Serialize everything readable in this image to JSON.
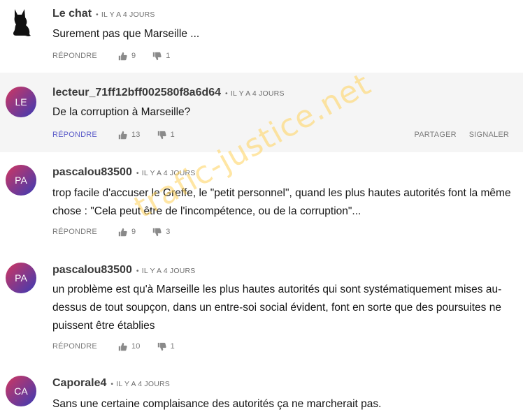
{
  "comments": [
    {
      "author": "Le chat",
      "time": "IL Y A 4 JOURS",
      "text": "Surement pas que Marseille ...",
      "reply": "RÉPONDRE",
      "up": "9",
      "down": "1",
      "avatar_icon": "black-cat-icon"
    },
    {
      "author": "lecteur_71ff12bff002580f8a6d64",
      "time": "IL Y A 4 JOURS",
      "text": "De la corruption à Marseille?",
      "reply": "RÉPONDRE",
      "up": "13",
      "down": "1",
      "initials": "LE",
      "share": "PARTAGER",
      "report": "SIGNALER",
      "highlight_color": "#f5f5f5"
    },
    {
      "author": "pascalou83500",
      "time": "IL Y A 4 JOURS",
      "text": "trop facile d'accuser le Greffe, le \"petit personnel\", quand les plus hautes autorités font la même chose : \"Cela peut être de l'incompétence, ou de la corruption\"...",
      "reply": "RÉPONDRE",
      "up": "9",
      "down": "3",
      "initials": "PA"
    },
    {
      "author": "pascalou83500",
      "time": "IL Y A 4 JOURS",
      "text": "un problème est qu'à Marseille les plus hautes autorités qui sont systématiquement mises au-dessus de tout soupçon, dans un entre-soi social évident, font en sorte que des poursuites ne puissent être établies",
      "reply": "RÉPONDRE",
      "up": "10",
      "down": "1",
      "initials": "PA"
    },
    {
      "author": "Caporale4",
      "time": "IL Y A 4 JOURS",
      "text": "Sans une certaine complaisance des autorités ça ne marcherait pas.",
      "initials": "CA"
    }
  ],
  "watermark": "trafic-justice.net",
  "colors": {
    "avatar_gradient_start": "#d1365f",
    "avatar_gradient_end": "#3b3bb5",
    "reply_active": "#5b5cc9",
    "watermark": "#ffd25a"
  }
}
